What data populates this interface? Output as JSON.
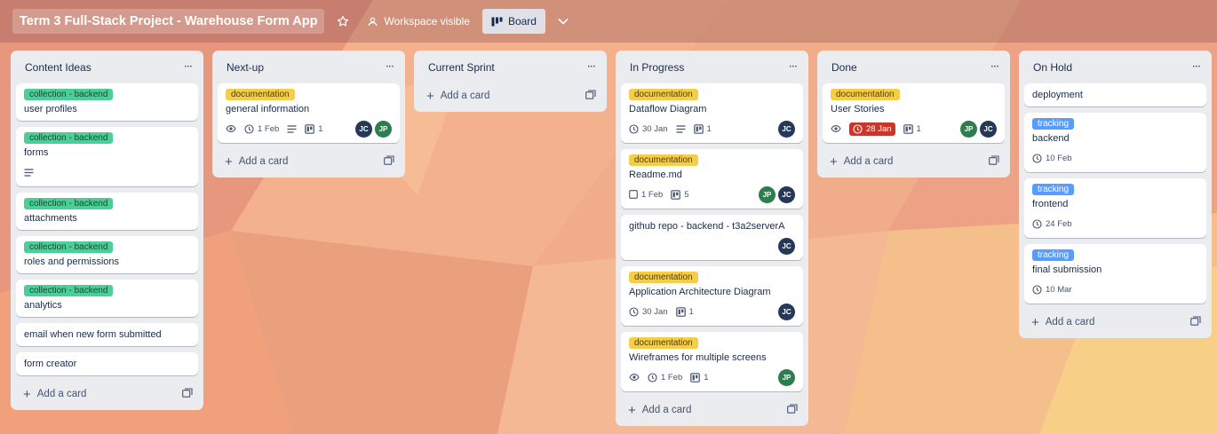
{
  "topbar": {
    "board_title": "Term 3 Full-Stack Project - Warehouse Form App",
    "visibility_label": "Workspace visible",
    "view_label": "Board"
  },
  "add_card_label": "Add a card",
  "lists": [
    {
      "title": "Content Ideas",
      "cards": [
        {
          "label": {
            "text": "collection - backend",
            "color": "green"
          },
          "title": "user profiles"
        },
        {
          "label": {
            "text": "collection - backend",
            "color": "green"
          },
          "title": "forms",
          "badges": {
            "description": true
          }
        },
        {
          "label": {
            "text": "collection - backend",
            "color": "green"
          },
          "title": "attachments"
        },
        {
          "label": {
            "text": "collection - backend",
            "color": "green"
          },
          "title": "roles and permissions"
        },
        {
          "label": {
            "text": "collection - backend",
            "color": "green"
          },
          "title": "analytics"
        },
        {
          "title": "email when new form submitted"
        },
        {
          "title": "form creator"
        }
      ]
    },
    {
      "title": "Next-up",
      "cards": [
        {
          "label": {
            "text": "documentation",
            "color": "yellow"
          },
          "title": "general information",
          "badges": {
            "watch": true,
            "due": "1 Feb",
            "description": true,
            "attachments": "1"
          },
          "members": [
            "JC",
            "JP"
          ]
        }
      ]
    },
    {
      "title": "Current Sprint",
      "cards": []
    },
    {
      "title": "In Progress",
      "cards": [
        {
          "label": {
            "text": "documentation",
            "color": "yellow"
          },
          "title": "Dataflow Diagram",
          "badges": {
            "due": "30 Jan",
            "description": true,
            "attachments": "1"
          },
          "members": [
            "JC"
          ]
        },
        {
          "label": {
            "text": "documentation",
            "color": "yellow"
          },
          "title": "Readme.md",
          "badges": {
            "start": "1 Feb",
            "attachments": "5"
          },
          "members": [
            "JP",
            "JC"
          ]
        },
        {
          "title": "github repo - backend - t3a2serverA",
          "members": [
            "JC"
          ]
        },
        {
          "label": {
            "text": "documentation",
            "color": "yellow"
          },
          "title": "Application Architecture Diagram",
          "badges": {
            "due": "30 Jan",
            "attachments": "1"
          },
          "members": [
            "JC"
          ]
        },
        {
          "label": {
            "text": "documentation",
            "color": "yellow"
          },
          "title": "Wireframes for multiple screens",
          "badges": {
            "watch": true,
            "due": "1 Feb",
            "attachments": "1"
          },
          "members": [
            "JP"
          ]
        }
      ]
    },
    {
      "title": "Done",
      "cards": [
        {
          "label": {
            "text": "documentation",
            "color": "yellow"
          },
          "title": "User Stories",
          "badges": {
            "watch": true,
            "due_overdue": "28 Jan",
            "attachments": "1"
          },
          "members": [
            "JP",
            "JC"
          ]
        }
      ]
    },
    {
      "title": "On Hold",
      "cards": [
        {
          "title": "deployment"
        },
        {
          "label": {
            "text": "tracking",
            "color": "blue"
          },
          "title": "backend",
          "badges": {
            "due": "10 Feb"
          }
        },
        {
          "label": {
            "text": "tracking",
            "color": "blue"
          },
          "title": "frontend",
          "badges": {
            "due": "24 Feb"
          }
        },
        {
          "label": {
            "text": "tracking",
            "color": "blue"
          },
          "title": "final submission",
          "badges": {
            "due": "10 Mar"
          }
        }
      ]
    }
  ]
}
